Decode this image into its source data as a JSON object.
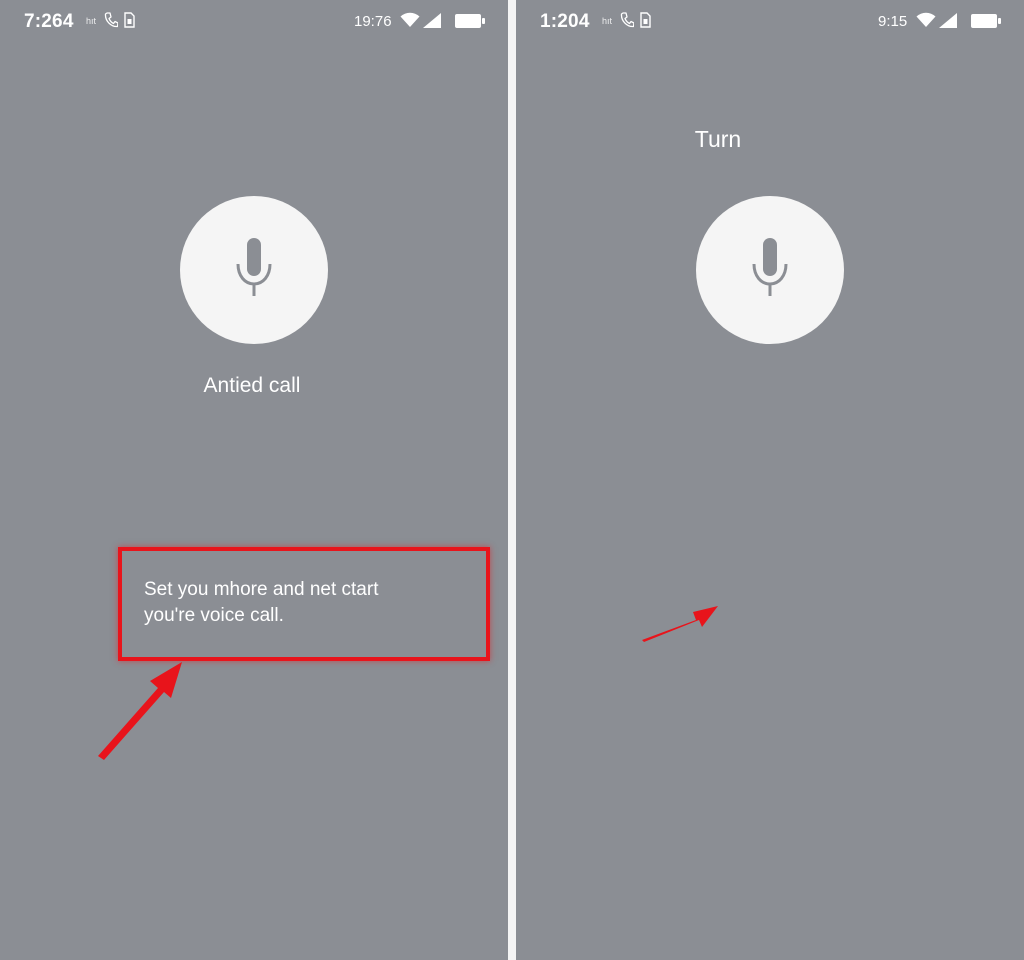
{
  "left_screen": {
    "status_bar": {
      "time": "7:264",
      "carrier": "hıt",
      "right_time": "19:76"
    },
    "caption": "Antied call",
    "hint": {
      "line1": "Set you mhore and net ctart",
      "line2": "you're voice call."
    }
  },
  "right_screen": {
    "status_bar": {
      "time": "1:204",
      "carrier": "hıt",
      "right_time": "9:15"
    },
    "title": "Turn"
  },
  "icons": {
    "microphone": "mic-icon",
    "phone": "phone-icon",
    "sim": "sim-icon",
    "wifi": "wifi-icon",
    "signal": "signal-icon",
    "battery": "battery-icon",
    "arrow": "arrow-icon"
  },
  "colors": {
    "background": "#8b8e94",
    "annotation_red": "#e8141b",
    "mic_circle": "#f5f5f5"
  }
}
